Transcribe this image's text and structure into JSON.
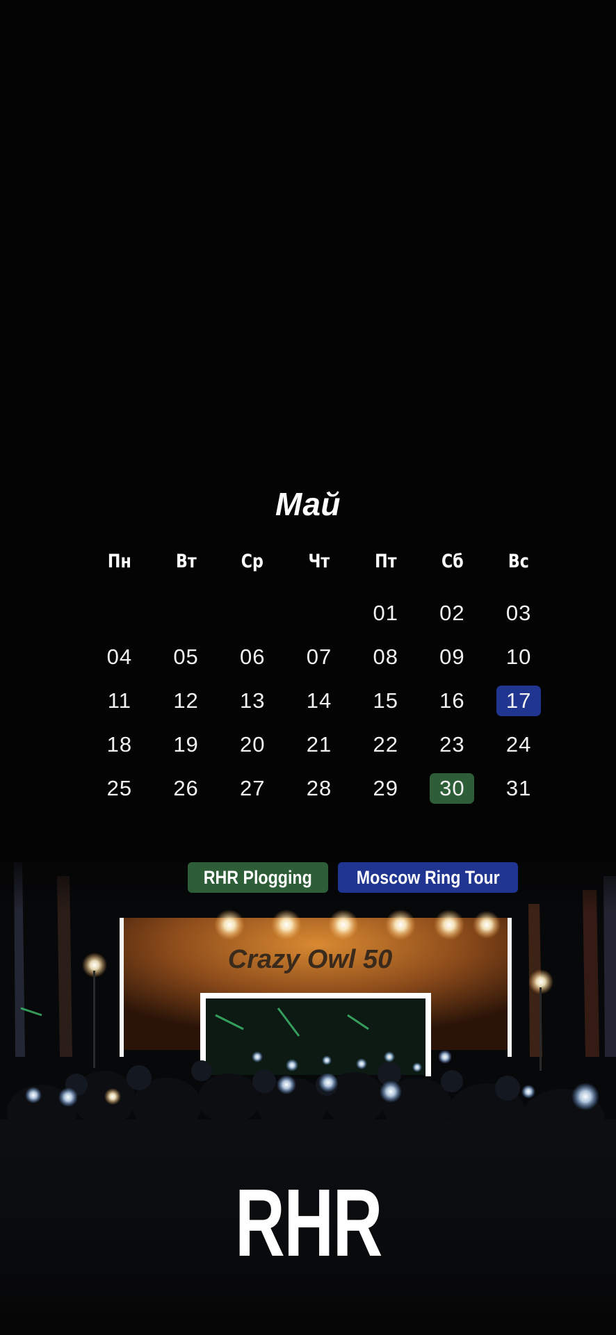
{
  "calendar": {
    "month": "Май",
    "weekdays": [
      "Пн",
      "Вт",
      "Ср",
      "Чт",
      "Пт",
      "Сб",
      "Вс"
    ],
    "weeks": [
      [
        "",
        "",
        "",
        "",
        "01",
        "02",
        "03"
      ],
      [
        "04",
        "05",
        "06",
        "07",
        "08",
        "09",
        "10"
      ],
      [
        "11",
        "12",
        "13",
        "14",
        "15",
        "16",
        "17"
      ],
      [
        "18",
        "19",
        "20",
        "21",
        "22",
        "23",
        "24"
      ],
      [
        "25",
        "26",
        "27",
        "28",
        "29",
        "30",
        "31"
      ]
    ],
    "highlights": {
      "17": "#1f3590",
      "30": "#2d5e37"
    }
  },
  "legend": [
    {
      "label": "RHR Plogging",
      "color": "#2d5e37"
    },
    {
      "label": "Moscow Ring Tour",
      "color": "#1f3590"
    }
  ],
  "photo": {
    "banner_text": "Crazy Owl 50"
  },
  "brand": {
    "logo": "RHR"
  },
  "colors": {
    "background": "#040404",
    "text": "#ffffff",
    "accent_blue": "#1f3590",
    "accent_green": "#2d5e37"
  }
}
